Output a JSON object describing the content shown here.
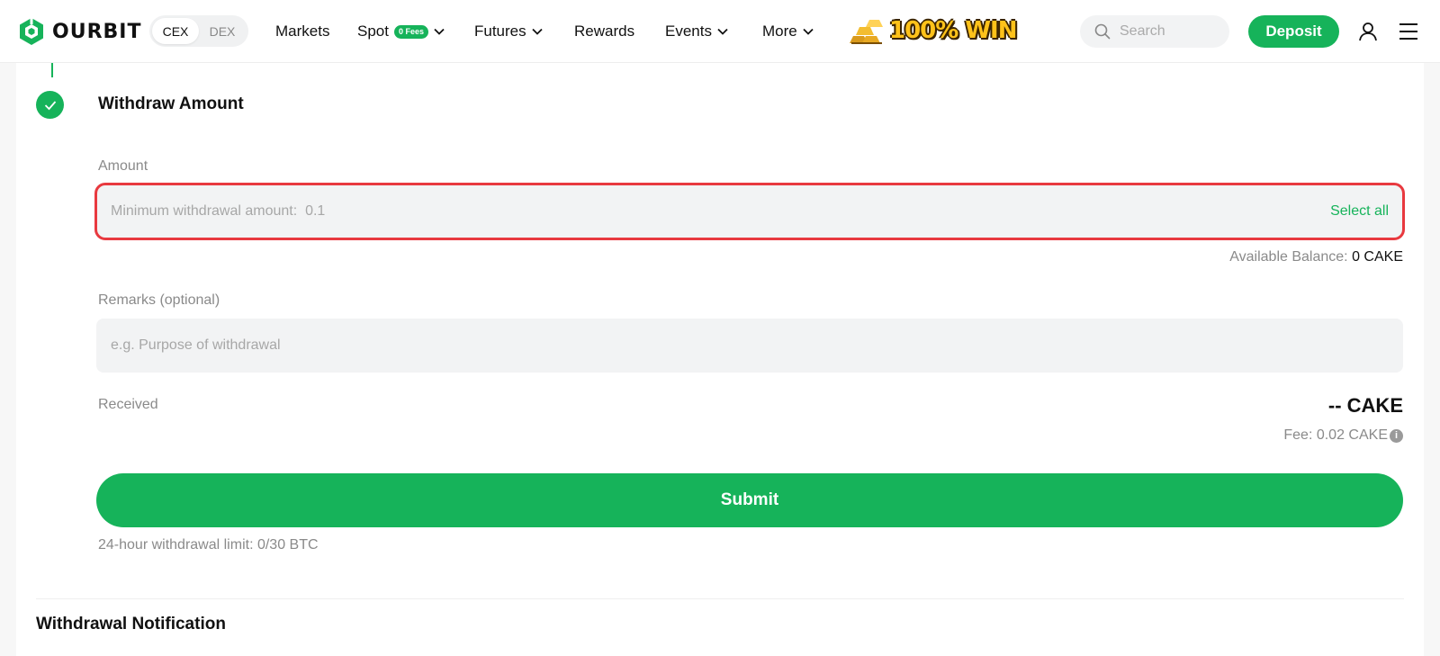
{
  "header": {
    "brand": "OURBIT",
    "mode_options": [
      "CEX",
      "DEX"
    ],
    "nav": {
      "markets": "Markets",
      "spot": "Spot",
      "spot_badge": "0 Fees",
      "futures": "Futures",
      "rewards": "Rewards",
      "events": "Events",
      "more": "More"
    },
    "promo_text": "100% WIN",
    "search_placeholder": "Search",
    "deposit_label": "Deposit"
  },
  "withdraw": {
    "step_title": "Withdraw Amount",
    "amount_label": "Amount",
    "amount_placeholder": "Minimum withdrawal amount:  0.1",
    "select_all": "Select all",
    "available_label": "Available Balance:",
    "available_value": "0 CAKE",
    "remarks_label": "Remarks (optional)",
    "remarks_placeholder": "e.g. Purpose of withdrawal",
    "received_label": "Received",
    "received_value": "-- CAKE",
    "fee_text": "Fee: 0.02 CAKE",
    "submit_label": "Submit",
    "limit_text": "24-hour withdrawal limit: 0/30 BTC"
  },
  "notification": {
    "title": "Withdrawal Notification"
  },
  "colors": {
    "accent": "#16b35a",
    "highlight_border": "#e8393f"
  }
}
